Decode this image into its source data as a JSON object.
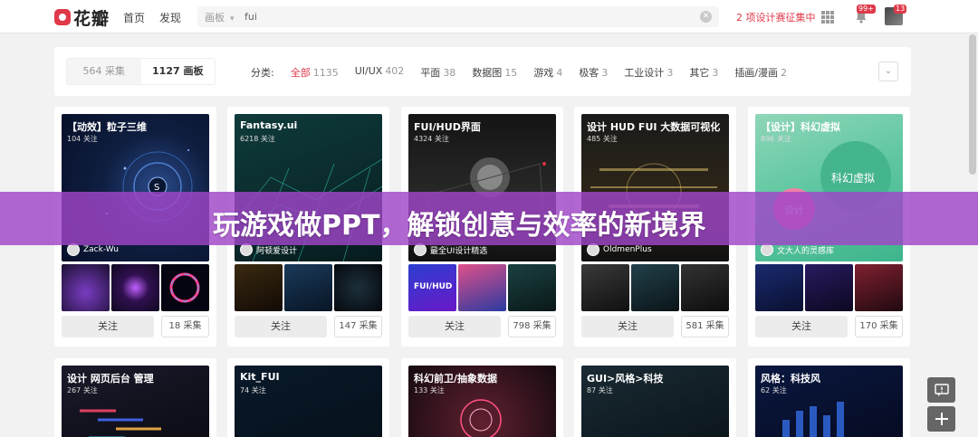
{
  "nav": {
    "logo_text": "花瓣",
    "links": [
      "首页",
      "发现"
    ],
    "search": {
      "scope": "画板",
      "value": "fui"
    },
    "promo": "2 项设计赛征集中",
    "notification_badge": "99+",
    "avatar_badge": "13"
  },
  "filter": {
    "toggle": [
      {
        "label": "564 采集"
      },
      {
        "label": "1127 画板"
      }
    ],
    "category_prefix": "分类:",
    "categories": [
      {
        "label": "全部",
        "count": "1135"
      },
      {
        "label": "UI/UX",
        "count": "402"
      },
      {
        "label": "平面",
        "count": "38"
      },
      {
        "label": "数据图",
        "count": "15"
      },
      {
        "label": "游戏",
        "count": "4"
      },
      {
        "label": "极客",
        "count": "3"
      },
      {
        "label": "工业设计",
        "count": "3"
      },
      {
        "label": "其它",
        "count": "3"
      },
      {
        "label": "插画/漫画",
        "count": "2"
      }
    ]
  },
  "boards": [
    {
      "title": "【动效】粒子三维",
      "fans": "104 关注",
      "owner": "Zack-Wu",
      "follow": "关注",
      "collect": "18 采集"
    },
    {
      "title": "Fantasy.ui",
      "fans": "6218 关注",
      "owner": "阿顿爱设计",
      "follow": "关注",
      "collect": "147 采集"
    },
    {
      "title": "FUI/HUD界面",
      "fans": "4324 关注",
      "owner": "最全UI设计精选",
      "follow": "关注",
      "collect": "798 采集"
    },
    {
      "title": "设计 HUD FUI 大数据可视化",
      "fans": "485 关注",
      "owner": "OldmenPlus",
      "follow": "关注",
      "collect": "581 采集"
    },
    {
      "title": "【设计】科幻虚拟",
      "fans": "896 关注",
      "owner": "文大人的灵感库",
      "follow": "关注",
      "collect": "170 采集",
      "cover_text": [
        "科幻虚拟",
        "设计"
      ]
    },
    {
      "title": "设计 网页后台 管理",
      "fans": "267 关注"
    },
    {
      "title": "Kit_FUI",
      "fans": "74 关注"
    },
    {
      "title": "科幻前卫/抽象数据",
      "fans": "133 关注"
    },
    {
      "title": "GUI>风格>科技",
      "fans": "87 关注"
    },
    {
      "title": "风格：科技风",
      "fans": "62 关注"
    }
  ],
  "thumb_text": {
    "fui_hud": "FUI/HUD"
  },
  "banner": {
    "text": "玩游戏做PPT，解锁创意与效率的新境界"
  },
  "colors": {
    "accent": "#e0394a",
    "banner": "#a046c8"
  },
  "icons": [
    "logo-icon",
    "chevron-down-icon",
    "clear-icon",
    "apps-grid-icon",
    "bell-icon",
    "collapse-icon",
    "feedback-icon",
    "add-icon"
  ]
}
